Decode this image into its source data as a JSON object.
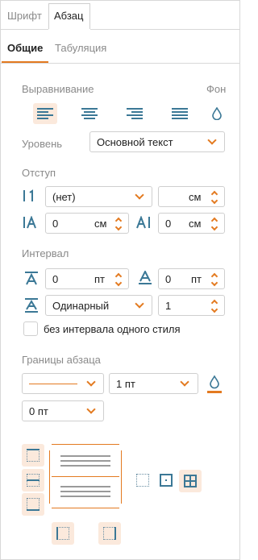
{
  "tabs": {
    "font": "Шрифт",
    "paragraph": "Абзац"
  },
  "subtabs": {
    "general": "Общие",
    "tabulation": "Табуляция"
  },
  "alignment": {
    "label": "Выравнивание",
    "background_label": "Фон"
  },
  "level": {
    "label": "Уровень",
    "value": "Основной текст"
  },
  "indent": {
    "label": "Отступ",
    "first_line": {
      "type": "(нет)",
      "unit": "см"
    },
    "left": {
      "value": "0",
      "unit": "см"
    },
    "right": {
      "value": "0",
      "unit": "см"
    }
  },
  "spacing": {
    "label": "Интервал",
    "before": {
      "value": "0",
      "unit": "пт"
    },
    "after": {
      "value": "0",
      "unit": "пт"
    },
    "line": {
      "type": "Одинарный",
      "value": "1"
    },
    "no_spacing_same_style": "без интервала одного стиля"
  },
  "borders": {
    "label": "Границы абзаца",
    "width": "1 пт",
    "offset": "0 пт"
  },
  "colors": {
    "accent": "#e37a20",
    "icon": "#3b7896",
    "highlight": "#fbe9dc",
    "border": "#cfcfcf"
  }
}
